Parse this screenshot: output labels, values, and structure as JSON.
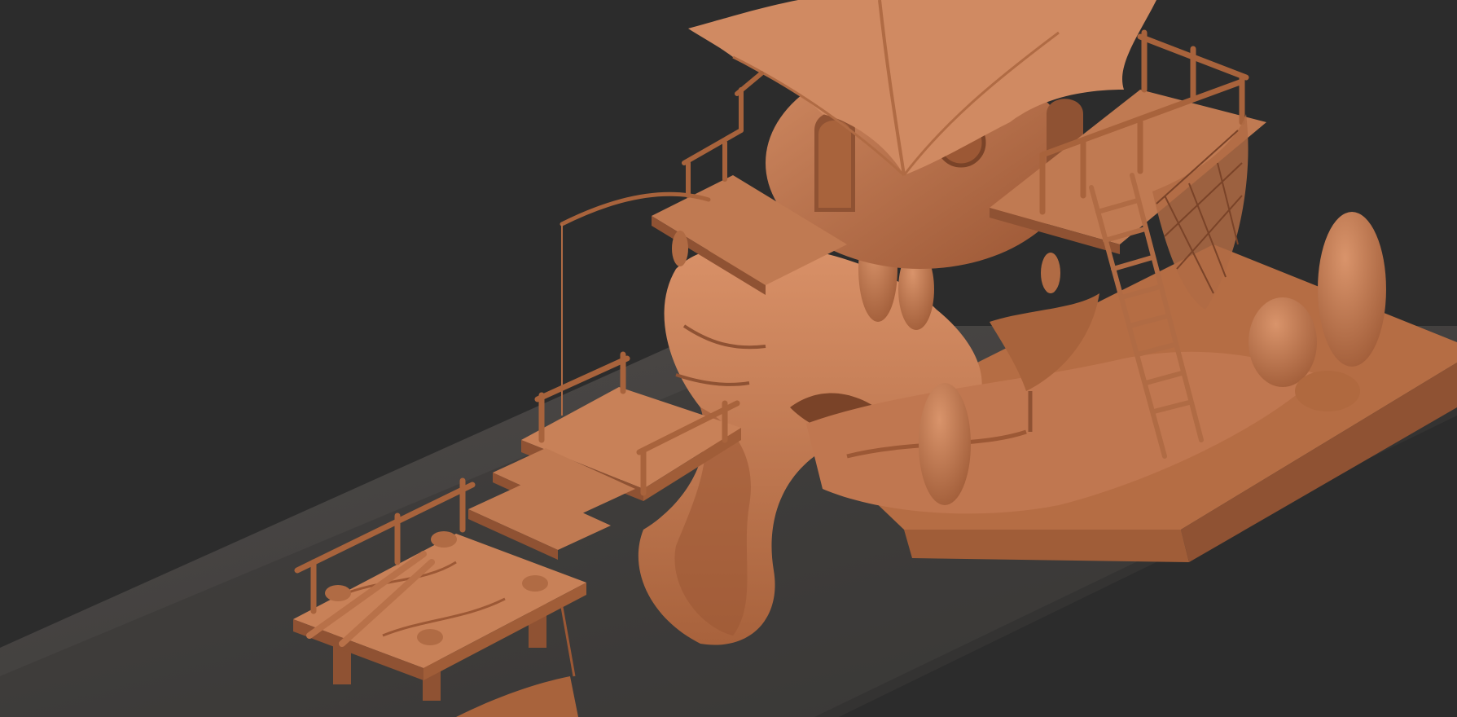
{
  "scene": {
    "subject": "fishing-hut-on-rock-sculpt",
    "colors": {
      "background": "#2c2c2c",
      "water": "#454241",
      "water_dark": "#333131",
      "clay": "#c27a4e",
      "clay_light": "#d99168",
      "clay_dark": "#8f5233",
      "clay_shadow": "#6e3d24"
    }
  }
}
